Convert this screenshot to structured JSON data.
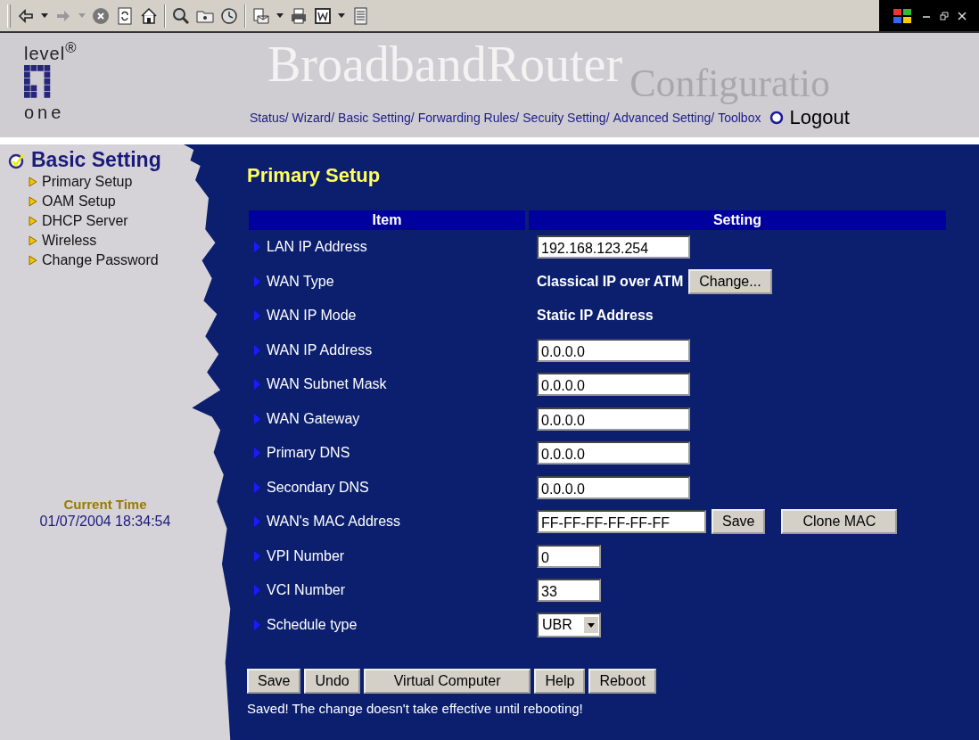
{
  "header": {
    "logo_top": "level$^{®}$",
    "logo_bottom": "one",
    "title": "BroadbandRouter",
    "subtitle": "Configuratio",
    "nav": [
      "Status/",
      "Wizard/",
      "Basic Setting/",
      "Forwarding Rules/",
      "Secuity Setting/",
      "Advanced Setting/",
      "Toolbox"
    ],
    "logout": "Logout"
  },
  "sidebar": {
    "section": "Basic Setting",
    "items": [
      {
        "label": "Primary Setup"
      },
      {
        "label": "OAM Setup"
      },
      {
        "label": "DHCP Server"
      },
      {
        "label": "Wireless"
      },
      {
        "label": "Change Password"
      }
    ],
    "time_label": "Current Time",
    "time": "01/07/2004 18:34:54"
  },
  "main": {
    "title": "Primary Setup",
    "columns": [
      "Item",
      "Setting"
    ],
    "rows": [
      {
        "label": "LAN IP Address",
        "kind": "ip-input",
        "value": "192.168.123.254"
      },
      {
        "label": "WAN Type",
        "kind": "text",
        "value": "Classical IP over ATM",
        "buttons": [
          "Change..."
        ]
      },
      {
        "label": "WAN IP Mode",
        "kind": "text",
        "value": "Static IP Address"
      },
      {
        "label": "WAN IP Address",
        "kind": "ip-input",
        "value": "0.0.0.0"
      },
      {
        "label": "WAN Subnet Mask",
        "kind": "ip-input",
        "value": "0.0.0.0"
      },
      {
        "label": "WAN Gateway",
        "kind": "ip-input",
        "value": "0.0.0.0"
      },
      {
        "label": "Primary DNS",
        "kind": "ip-input",
        "value": "0.0.0.0"
      },
      {
        "label": "Secondary DNS",
        "kind": "ip-input",
        "value": "0.0.0.0"
      },
      {
        "label": "WAN's MAC Address",
        "kind": "mac-input",
        "value": "FF-FF-FF-FF-FF-FF",
        "buttons": [
          "Save",
          "Clone MAC"
        ]
      },
      {
        "label": "VPI Number",
        "kind": "number-input",
        "value": "0"
      },
      {
        "label": "VCI Number",
        "kind": "number-input",
        "value": "33"
      },
      {
        "label": "Schedule type",
        "kind": "select",
        "value": "UBR"
      }
    ],
    "buttons": [
      "Save",
      "Undo",
      "Virtual Computer",
      "Help",
      "Reboot"
    ],
    "message": "Saved! The change doesn't take effective until rebooting!"
  }
}
